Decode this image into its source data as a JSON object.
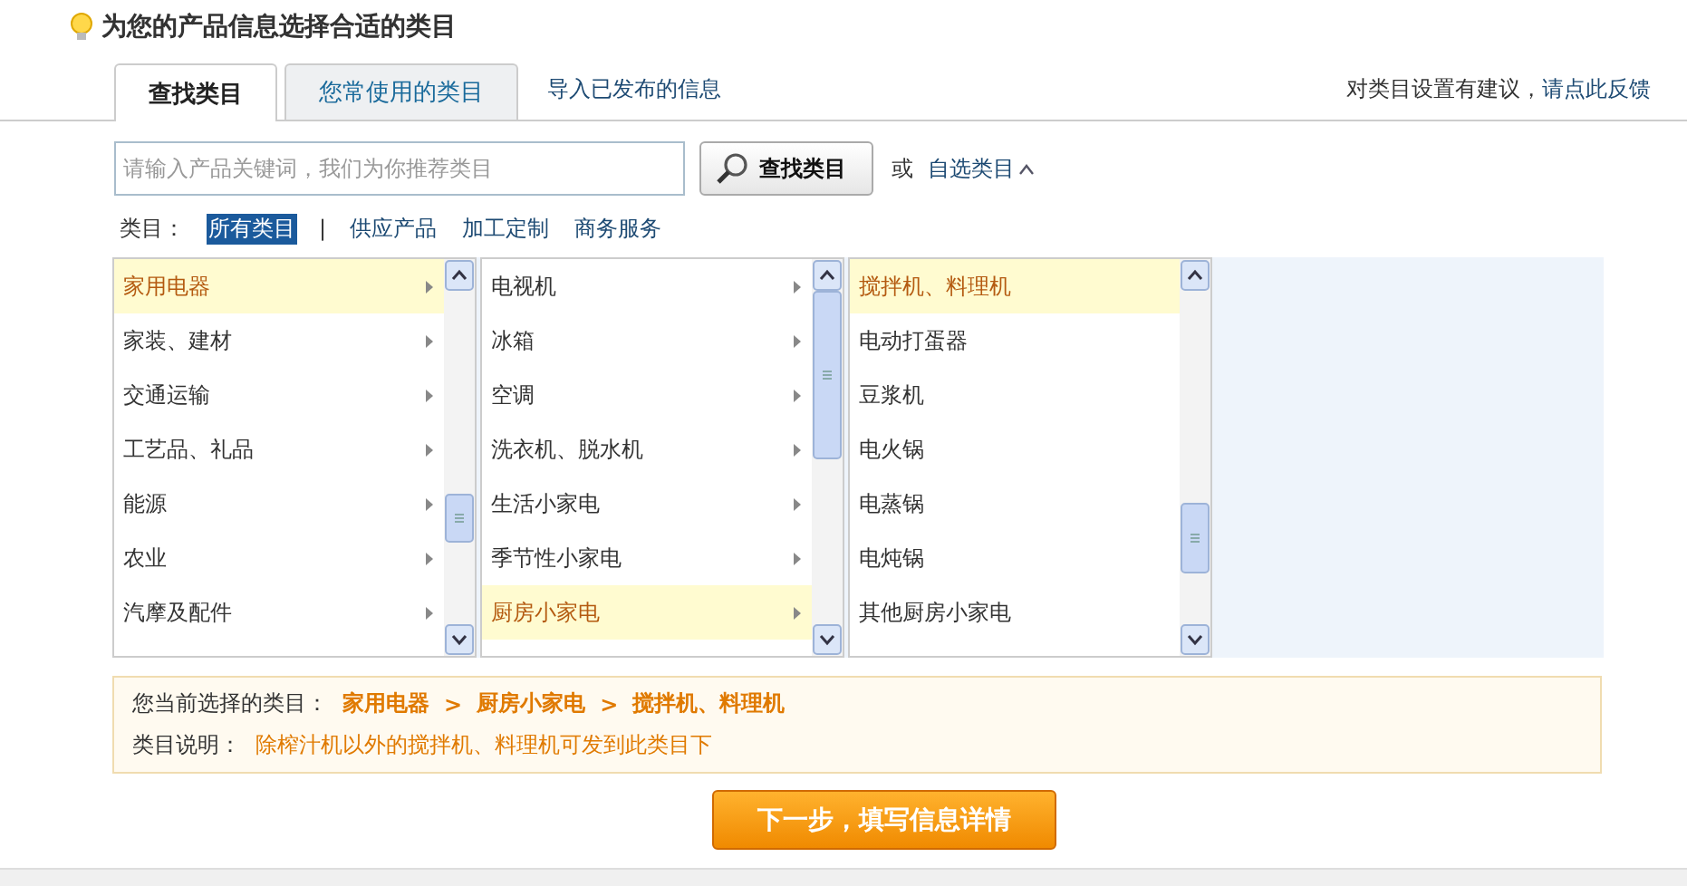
{
  "header": {
    "title": "为您的产品信息选择合适的类目"
  },
  "tabs": [
    {
      "label": "查找类目",
      "selected": true
    },
    {
      "label": "您常使用的类目",
      "selected": false
    }
  ],
  "import_link": "导入已发布的信息",
  "feedback": {
    "text": "对类目设置有建议，",
    "link": "请点此反馈"
  },
  "search": {
    "placeholder": "请输入产品关键词，我们为你推荐类目",
    "button": "查找类目",
    "or": "或",
    "custom_link": "自选类目",
    "custom_expanded": true
  },
  "filter": {
    "label": "类目：",
    "separator": "|",
    "options": [
      {
        "label": "所有类目",
        "selected": true
      },
      {
        "label": "供应产品",
        "selected": false
      },
      {
        "label": "加工定制",
        "selected": false
      },
      {
        "label": "商务服务",
        "selected": false
      }
    ]
  },
  "columns": [
    {
      "kind": "branch",
      "items": [
        {
          "label": "家用电器",
          "selected": true
        },
        {
          "label": "家装、建材",
          "selected": false
        },
        {
          "label": "交通运输",
          "selected": false
        },
        {
          "label": "工艺品、礼品",
          "selected": false
        },
        {
          "label": "能源",
          "selected": false
        },
        {
          "label": "农业",
          "selected": false
        },
        {
          "label": "汽摩及配件",
          "selected": false
        }
      ]
    },
    {
      "kind": "branch",
      "items": [
        {
          "label": "电视机",
          "selected": false
        },
        {
          "label": "冰箱",
          "selected": false
        },
        {
          "label": "空调",
          "selected": false
        },
        {
          "label": "洗衣机、脱水机",
          "selected": false
        },
        {
          "label": "生活小家电",
          "selected": false
        },
        {
          "label": "季节性小家电",
          "selected": false
        },
        {
          "label": "厨房小家电",
          "selected": true
        }
      ]
    },
    {
      "kind": "leaf",
      "items": [
        {
          "label": "搅拌机、料理机",
          "selected": true
        },
        {
          "label": "电动打蛋器",
          "selected": false
        },
        {
          "label": "豆浆机",
          "selected": false
        },
        {
          "label": "电火锅",
          "selected": false
        },
        {
          "label": "电蒸锅",
          "selected": false
        },
        {
          "label": "电炖锅",
          "selected": false
        },
        {
          "label": "其他厨房小家电",
          "selected": false
        }
      ]
    }
  ],
  "selection": {
    "label": "您当前选择的类目：",
    "separator": ">",
    "path": [
      "家用电器",
      "厨房小家电",
      "搅拌机、料理机"
    ],
    "note_label": "类目说明：",
    "note": "除榨汁机以外的搅拌机、料理机可发到此类目下"
  },
  "next_button": "下一步，填写信息详情"
}
